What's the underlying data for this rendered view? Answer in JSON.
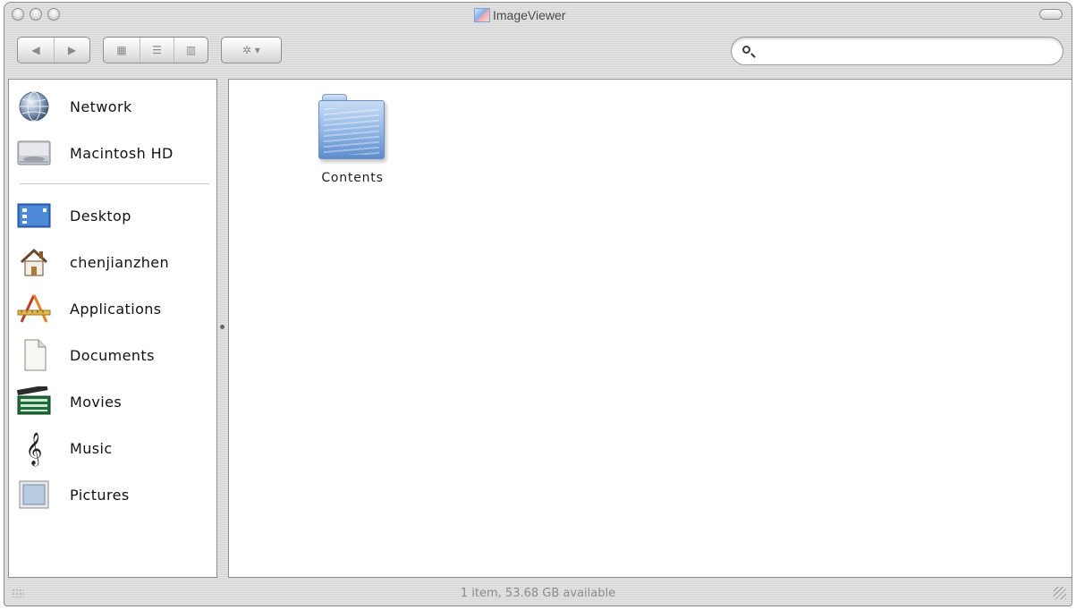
{
  "window": {
    "title": "ImageViewer"
  },
  "toolbar": {
    "back_label": "◀",
    "forward_label": "▶",
    "view_icon_label": "▦",
    "view_list_label": "☰",
    "view_column_label": "▥",
    "action_label": "✲ ▾",
    "search_placeholder": "",
    "search_value": ""
  },
  "sidebar": {
    "devices": [
      {
        "label": "Network",
        "icon": "network-globe-icon"
      },
      {
        "label": "Macintosh HD",
        "icon": "hard-drive-icon"
      }
    ],
    "places": [
      {
        "label": "Desktop",
        "icon": "desktop-icon"
      },
      {
        "label": "chenjianzhen",
        "icon": "home-icon"
      },
      {
        "label": "Applications",
        "icon": "applications-icon"
      },
      {
        "label": "Documents",
        "icon": "documents-icon"
      },
      {
        "label": "Movies",
        "icon": "movies-icon"
      },
      {
        "label": "Music",
        "icon": "music-icon"
      },
      {
        "label": "Pictures",
        "icon": "pictures-icon"
      }
    ]
  },
  "content": {
    "items": [
      {
        "label": "Contents",
        "icon": "folder-icon"
      }
    ]
  },
  "status": {
    "text": "1 item, 53.68 GB available"
  }
}
